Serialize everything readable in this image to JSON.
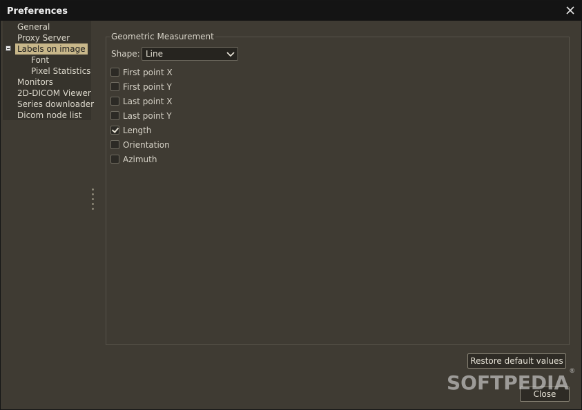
{
  "window": {
    "title": "Preferences"
  },
  "tree": {
    "items": [
      {
        "label": "General"
      },
      {
        "label": "Proxy Server"
      },
      {
        "label": "Labels on image"
      },
      {
        "label": "Font"
      },
      {
        "label": "Pixel Statistics"
      },
      {
        "label": "Monitors"
      },
      {
        "label": "2D-DICOM Viewer"
      },
      {
        "label": "Series downloader"
      },
      {
        "label": "Dicom node list"
      }
    ],
    "selected": "Labels on image"
  },
  "panel": {
    "group_title": "Geometric Measurement",
    "shape_label": "Shape:",
    "shape_value": "Line",
    "checkboxes": [
      {
        "label": "First point X",
        "checked": false
      },
      {
        "label": "First point Y",
        "checked": false
      },
      {
        "label": "Last point X",
        "checked": false
      },
      {
        "label": "Last point Y",
        "checked": false
      },
      {
        "label": "Length",
        "checked": true
      },
      {
        "label": "Orientation",
        "checked": false
      },
      {
        "label": "Azimuth",
        "checked": false
      }
    ]
  },
  "buttons": {
    "restore": "Restore default values",
    "close": "Close"
  },
  "watermark": {
    "text": "SOFTPEDIA",
    "mark": "®"
  },
  "colors": {
    "selection": "#c8b78a",
    "background": "#3f3b33",
    "titlebar": "#141414"
  }
}
